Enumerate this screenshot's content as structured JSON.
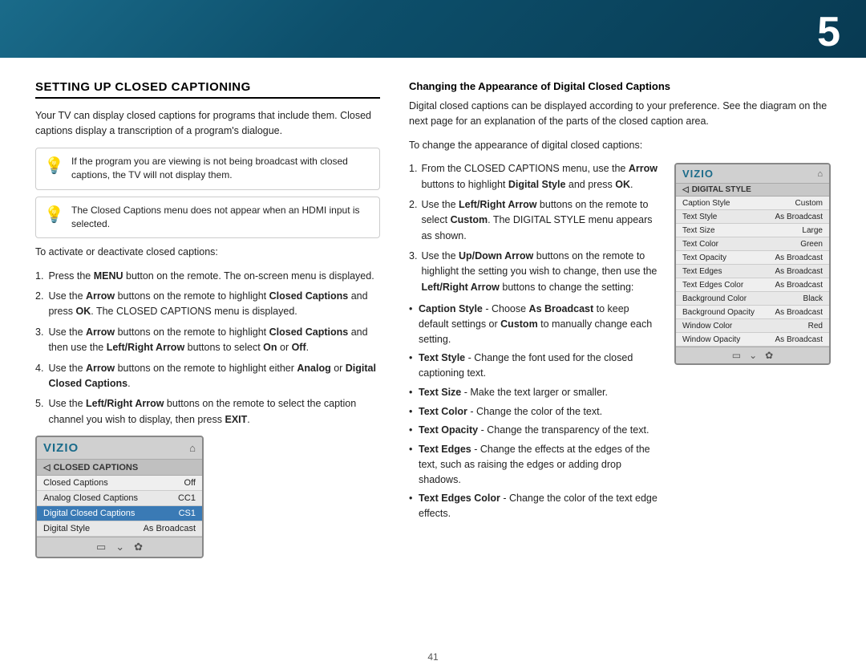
{
  "page": {
    "number": "5",
    "footer_page": "41"
  },
  "left": {
    "section_title": "SETTING UP CLOSED CAPTIONING",
    "intro_text": "Your TV can display closed captions for programs that include them. Closed captions display a transcription of a program's dialogue.",
    "info_box_1": "If the program you are viewing is not being broadcast with closed captions, the TV will not display them.",
    "info_box_2": "The Closed Captions menu does not appear when an HDMI input is selected.",
    "activate_label": "To activate or deactivate closed captions:",
    "steps": [
      {
        "num": "1.",
        "text_before": "Press the ",
        "bold1": "MENU",
        "text_after": " button on the remote. The on-screen menu is displayed."
      },
      {
        "num": "2.",
        "text_before": "Use the ",
        "bold1": "Arrow",
        "text_after": " buttons on the remote to highlight ",
        "bold2": "Closed Captions",
        "text_after2": " and press ",
        "bold3": "OK",
        "text_after3": ". The CLOSED CAPTIONS menu is displayed."
      },
      {
        "num": "3.",
        "text_before": "Use the ",
        "bold1": "Arrow",
        "text_after": " buttons on the remote to highlight ",
        "bold2": "Closed Captions",
        "text_after2": " and then use the ",
        "bold3": "Left/Right Arrow",
        "text_after3": " buttons to select ",
        "bold4": "On",
        "text_after4": " or ",
        "bold5": "Off",
        "text_after5": "."
      },
      {
        "num": "4.",
        "text_before": "Use the ",
        "bold1": "Arrow",
        "text_after": " buttons on the remote to highlight either ",
        "bold2": "Analog",
        "text_after2": " or ",
        "bold3": "Digital Closed Captions",
        "text_after3": "."
      },
      {
        "num": "5.",
        "text_before": "Use the ",
        "bold1": "Left/Right Arrow",
        "text_after": " buttons on the remote to select the caption channel you wish to display, then press ",
        "bold2": "EXIT",
        "text_after2": "."
      }
    ],
    "vizio_menu": {
      "logo": "VIZIO",
      "section": "CLOSED CAPTIONS",
      "rows": [
        {
          "label": "Closed Captions",
          "value": "Off"
        },
        {
          "label": "Analog Closed Captions",
          "value": "CC1",
          "highlighted": false
        },
        {
          "label": "Digital Closed Captions",
          "value": "CS1",
          "highlighted": true
        },
        {
          "label": "Digital Style",
          "value": "As Broadcast"
        }
      ]
    }
  },
  "right": {
    "heading": "Changing the Appearance of Digital Closed Captions",
    "intro_text": "Digital closed captions can be displayed according to your preference. See the diagram on the next page for an explanation of the parts of the closed caption area.",
    "change_label": "To change the appearance of digital closed captions:",
    "steps": [
      {
        "num": "1.",
        "text_before": "From the CLOSED CAPTIONS menu, use the ",
        "bold1": "Arrow",
        "text_after": " buttons to highlight ",
        "bold2": "Digital Style",
        "text_after2": " and press ",
        "bold3": "OK",
        "text_after3": "."
      },
      {
        "num": "2.",
        "text_before": "Use the ",
        "bold1": "Left/Right Arrow",
        "text_after": " buttons on the remote to select ",
        "bold2": "Custom",
        "text_after2": ". The DIGITAL STYLE menu appears as shown."
      },
      {
        "num": "3.",
        "text_before": "Use the ",
        "bold1": "Up/Down Arrow",
        "text_after": " buttons on the remote to highlight the setting you wish to change, then use the ",
        "bold2": "Left/Right Arrow",
        "text_after2": " buttons to change the setting:"
      }
    ],
    "vizio_ds_menu": {
      "logo": "VIZIO",
      "section": "DIGITAL STYLE",
      "rows": [
        {
          "label": "Caption Style",
          "value": "Custom"
        },
        {
          "label": "Text Style",
          "value": "As Broadcast"
        },
        {
          "label": "Text Size",
          "value": "Large"
        },
        {
          "label": "Text Color",
          "value": "Green"
        },
        {
          "label": "Text Opacity",
          "value": "As Broadcast"
        },
        {
          "label": "Text Edges",
          "value": "As Broadcast"
        },
        {
          "label": "Text Edges Color",
          "value": "As Broadcast"
        },
        {
          "label": "Background Color",
          "value": "Black"
        },
        {
          "label": "Background Opacity",
          "value": "As Broadcast"
        },
        {
          "label": "Window Color",
          "value": "Red"
        },
        {
          "label": "Window Opacity",
          "value": "As Broadcast"
        }
      ]
    },
    "bullets": [
      {
        "bold": "Caption Style",
        "text": " - Choose ",
        "bold2": "As Broadcast",
        "text2": " to keep default settings or ",
        "bold3": "Custom",
        "text3": " to manually change each setting."
      },
      {
        "bold": "Text Style",
        "text": "  - Change the font used for the closed captioning text."
      },
      {
        "bold": "Text Size",
        "text": " - Make the text larger or smaller."
      },
      {
        "bold": "Text Color",
        "text": " - Change the color of the text."
      },
      {
        "bold": "Text Opacity",
        "text": " - Change the transparency of the text."
      },
      {
        "bold": "Text Edges",
        "text": " - Change the effects at the edges of the text, such as raising the edges or adding drop shadows."
      },
      {
        "bold": "Text Edges Color",
        "text": " - Change the color of the text edge effects."
      }
    ]
  }
}
